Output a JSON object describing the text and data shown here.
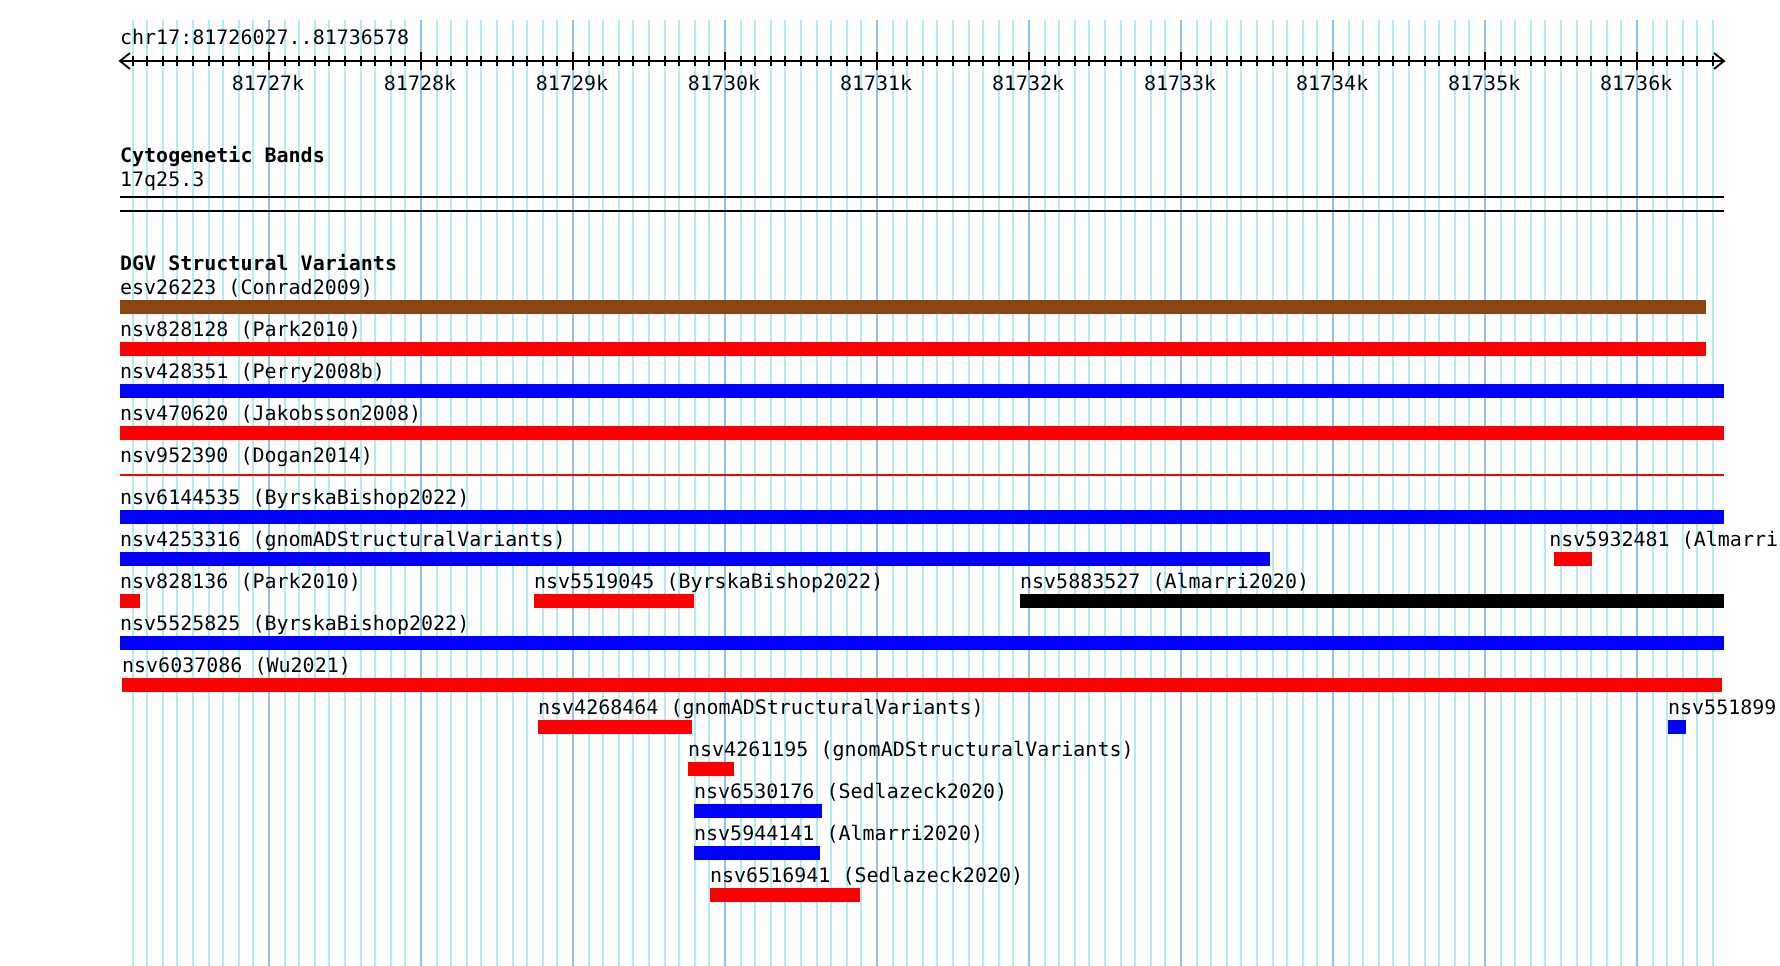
{
  "position_label": "chr17:81726027..81736578",
  "ruler": {
    "tick_labels": [
      "81727k",
      "81728k",
      "81729k",
      "81730k",
      "81731k",
      "81732k",
      "81733k",
      "81734k",
      "81735k",
      "81736k"
    ]
  },
  "cytoband_track": {
    "title": "Cytogenetic Bands",
    "band": "17q25.3"
  },
  "dgv_track": {
    "title": "DGV Structural Variants",
    "lanes": [
      {
        "features": [
          {
            "kind": "block",
            "label": "esv26223 (Conrad2009)",
            "color": "#8b4513"
          }
        ]
      },
      {
        "features": [
          {
            "kind": "block",
            "label": "nsv828128 (Park2010)",
            "color": "#ff0000"
          }
        ]
      },
      {
        "features": [
          {
            "kind": "block",
            "label": "nsv428351 (Perry2008b)",
            "color": "#0000ff"
          }
        ]
      },
      {
        "features": [
          {
            "kind": "block",
            "label": "nsv470620 (Jakobsson2008)",
            "color": "#ff0000"
          }
        ]
      },
      {
        "features": [
          {
            "kind": "line",
            "label": "nsv952390 (Dogan2014)",
            "color": "#ff0000"
          }
        ]
      },
      {
        "features": [
          {
            "kind": "block",
            "label": "nsv6144535 (ByrskaBishop2022)",
            "color": "#0000ff"
          }
        ]
      },
      {
        "features": [
          {
            "kind": "block",
            "label": "nsv4253316 (gnomADStructuralVariants)",
            "color": "#0000ff"
          },
          {
            "kind": "block",
            "label": "nsv5932481 (Almarri",
            "color": "#ff0000"
          }
        ]
      },
      {
        "features": [
          {
            "kind": "block",
            "label": "nsv828136 (Park2010)",
            "color": "#ff0000"
          },
          {
            "kind": "block",
            "label": "nsv5519045 (ByrskaBishop2022)",
            "color": "#ff0000"
          },
          {
            "kind": "block",
            "label": "nsv5883527 (Almarri2020)",
            "color": "#000000"
          }
        ]
      },
      {
        "features": [
          {
            "kind": "block",
            "label": "nsv5525825 (ByrskaBishop2022)",
            "color": "#0000ff"
          }
        ]
      },
      {
        "features": [
          {
            "kind": "block",
            "label": "nsv6037086 (Wu2021)",
            "color": "#ff0000"
          }
        ]
      },
      {
        "features": [
          {
            "kind": "block",
            "label": "nsv4268464 (gnomADStructuralVariants)",
            "color": "#ff0000"
          },
          {
            "kind": "block",
            "label": "nsv551899",
            "color": "#0000ff"
          }
        ]
      },
      {
        "features": [
          {
            "kind": "block",
            "label": "nsv4261195 (gnomADStructuralVariants)",
            "color": "#ff0000"
          }
        ]
      },
      {
        "features": [
          {
            "kind": "block",
            "label": "nsv6530176 (Sedlazeck2020)",
            "color": "#0000ff"
          }
        ]
      },
      {
        "features": [
          {
            "kind": "block",
            "label": "nsv5944141 (Almarri2020)",
            "color": "#0000ff"
          }
        ]
      },
      {
        "features": [
          {
            "kind": "block",
            "label": "nsv6516941 (Sedlazeck2020)",
            "color": "#ff0000"
          }
        ]
      }
    ]
  }
}
